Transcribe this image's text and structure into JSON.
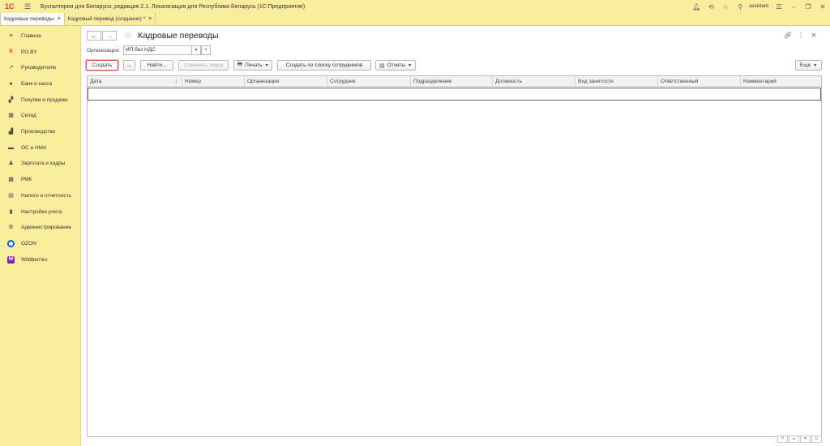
{
  "titlebar": {
    "logo": "1С",
    "title": "Бухгалтерия для Беларуси, редакция 2.1. Локализация для Республики Беларусь   (1С:Предприятие)",
    "user": "assistant"
  },
  "tabs": [
    {
      "label": "Кадровые переводы",
      "close": "×"
    },
    {
      "label": "Кадровый перевод (создание) *",
      "close": "×"
    }
  ],
  "sidebar": {
    "items": [
      {
        "label": "Главное",
        "icon": "menu-icon",
        "glyph": "≡"
      },
      {
        "label": "PO.BY",
        "icon": "rby-icon",
        "glyph": "R"
      },
      {
        "label": "Руководителю",
        "icon": "chart-trend-icon",
        "glyph": "↗"
      },
      {
        "label": "Банк и касса",
        "icon": "bank-icon",
        "glyph": "●"
      },
      {
        "label": "Покупки и продажи",
        "icon": "cart-icon",
        "glyph": "▞"
      },
      {
        "label": "Склад",
        "icon": "warehouse-icon",
        "glyph": "▦"
      },
      {
        "label": "Производство",
        "icon": "factory-icon",
        "glyph": "▟"
      },
      {
        "label": "ОС и НМА",
        "icon": "truck-icon",
        "glyph": "▬"
      },
      {
        "label": "Зарплата и кадры",
        "icon": "person-icon",
        "glyph": "♟"
      },
      {
        "label": "РМК",
        "icon": "register-icon",
        "glyph": "▩"
      },
      {
        "label": "Налоги и отчетность",
        "icon": "tax-icon",
        "glyph": "▤"
      },
      {
        "label": "Настройки учета",
        "icon": "book-icon",
        "glyph": "▮"
      },
      {
        "label": "Администрирование",
        "icon": "gear-icon",
        "glyph": "⚙"
      },
      {
        "label": "OZON",
        "icon": "ozon-icon",
        "glyph": ""
      },
      {
        "label": "Wildberries",
        "icon": "wildberries-icon",
        "glyph": "W"
      }
    ]
  },
  "main": {
    "title": "Кадровые переводы",
    "org_label": "Организация:",
    "org_value": "ИП без НДС",
    "buttons": {
      "create": "Создать",
      "find": "Найти...",
      "cancel_search": "Отменить поиск",
      "print": "Печать",
      "create_by_list": "Создать по списку сотрудников",
      "reports": "Отчеты",
      "more": "Еще"
    },
    "columns": [
      "Дата",
      "Номер",
      "Организация",
      "Сотрудник",
      "Подразделение",
      "Должность",
      "Вид занятости",
      "Ответственный",
      "Комментарий"
    ],
    "rows": []
  }
}
